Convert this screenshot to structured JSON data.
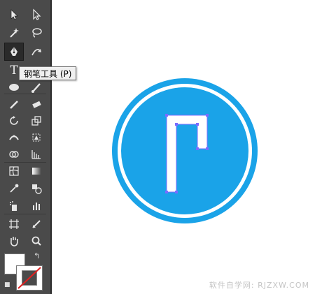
{
  "tooltip": {
    "text": "钢笔工具 (P)"
  },
  "icons": {
    "selection": "arrow-icon",
    "direct_selection": "white-arrow-icon",
    "pen": "pen-icon",
    "type": "type-icon",
    "ellipse": "ellipse-icon",
    "brush": "paintbrush-icon"
  },
  "type_tool_glyph": "T",
  "colors": {
    "toolbar_bg": "#4a4a4a",
    "circle_blue": "#1aa3e8",
    "canvas": "#ffffff"
  },
  "watermark": "软件自学网: RJZXW.COM"
}
